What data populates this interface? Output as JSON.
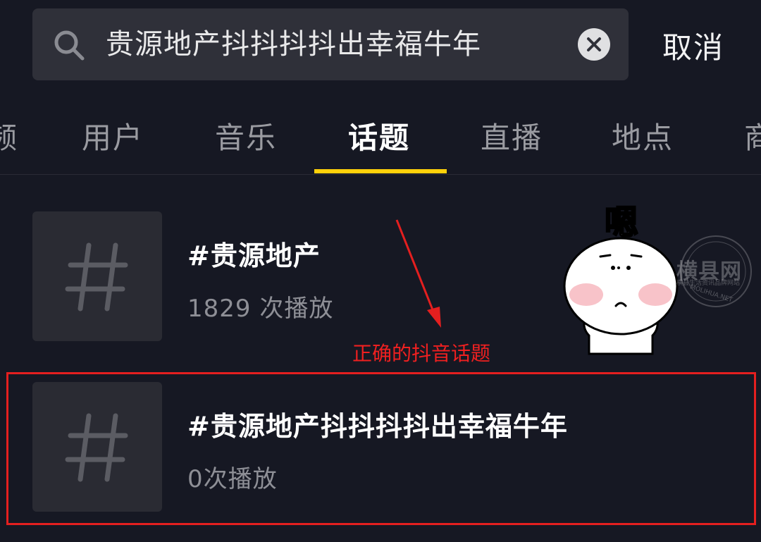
{
  "search": {
    "value": "贵源地产抖抖抖抖出幸福牛年",
    "cancel_label": "取消"
  },
  "tabs": [
    {
      "label": "视频"
    },
    {
      "label": "用户"
    },
    {
      "label": "音乐"
    },
    {
      "label": "话题",
      "active": true
    },
    {
      "label": "直播"
    },
    {
      "label": "地点"
    },
    {
      "label": "商品"
    }
  ],
  "results": [
    {
      "title": "#贵源地产",
      "plays": "1829 次播放"
    },
    {
      "title": "#贵源地产抖抖抖抖出幸福牛年",
      "plays": "0次播放"
    }
  ],
  "annotation": {
    "text": "正确的抖音话题"
  },
  "sticker": {
    "caption": "嗯"
  },
  "watermark": {
    "title": "横县网",
    "subtitle": "横县生活资讯品牌网站",
    "url": "MOLIHUA.NET"
  },
  "colors": {
    "background": "#161823",
    "accent": "#ffd10a",
    "annotation": "#e41f1f"
  }
}
